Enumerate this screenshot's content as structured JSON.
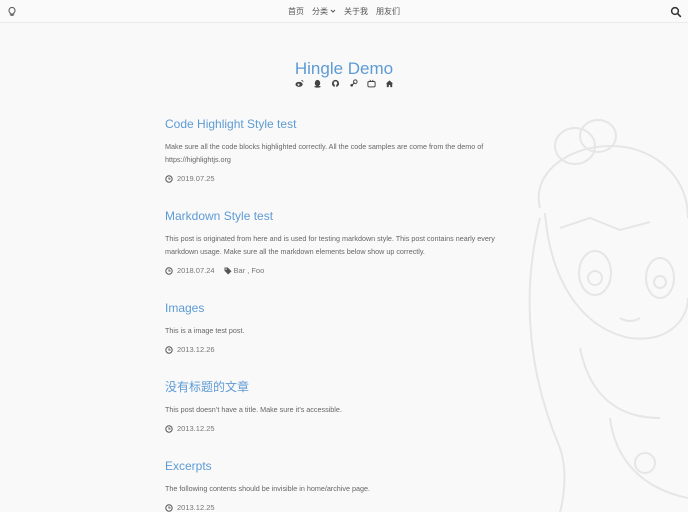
{
  "nav": {
    "items": [
      {
        "label": "首页"
      },
      {
        "label": "分类"
      },
      {
        "label": "关于我"
      },
      {
        "label": "朋友们"
      }
    ]
  },
  "site": {
    "title": "Hingle Demo"
  },
  "socials": [
    "weibo-icon",
    "qq-icon",
    "github-icon",
    "steam-icon",
    "bilibili-icon",
    "home-icon"
  ],
  "posts": [
    {
      "title": "Code Highlight Style test",
      "excerpt": "Make sure all the code blocks highlighted correctly. All the code samples are come from the demo of https://highlightjs.org",
      "date": "2019.07.25",
      "tags": []
    },
    {
      "title": "Markdown Style test",
      "excerpt": "This post is originated from here and is used for testing markdown style. This post contains nearly every markdown usage. Make sure all the markdown elements below show up correctly.",
      "date": "2018.07.24",
      "tags": [
        "Bar",
        "Foo"
      ]
    },
    {
      "title": "Images",
      "excerpt": "This is a image test post.",
      "date": "2013.12.26",
      "tags": []
    },
    {
      "title": "没有标题的文章",
      "excerpt": "This post doesn’t have a title. Make sure it’s accessible.",
      "date": "2013.12.25",
      "tags": []
    },
    {
      "title": "Excerpts",
      "excerpt": "The following contents should be invisible in home/archive page.",
      "date": "2013.12.25",
      "tags": []
    }
  ],
  "colors": {
    "accent": "#5d9bd5",
    "text": "#555555",
    "background": "#f9f9f9"
  }
}
